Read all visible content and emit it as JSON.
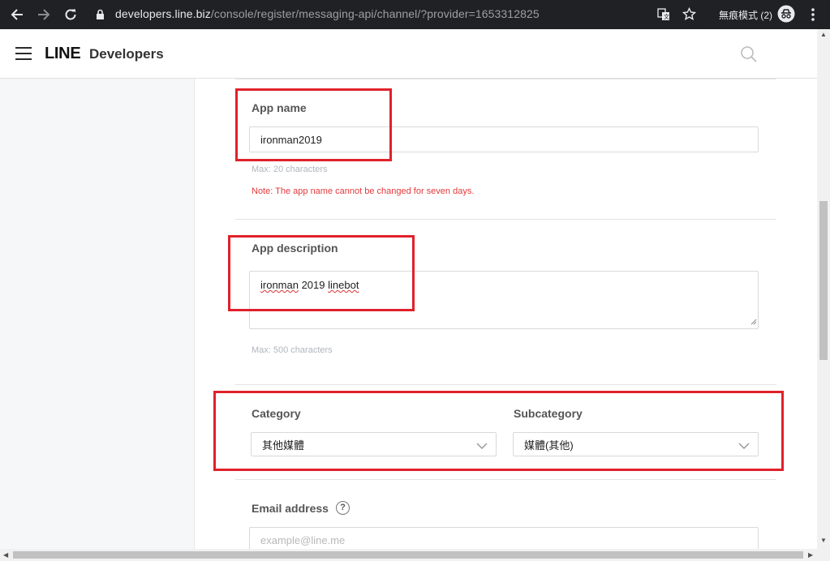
{
  "browser": {
    "url_host": "developers.line.biz",
    "url_path": "/console/register/messaging-api/channel/?provider=1653312825",
    "incognito_label": "無痕模式 (2)"
  },
  "header": {
    "brand_line": "LINE",
    "brand_developers": "Developers"
  },
  "form": {
    "app_name": {
      "label": "App name",
      "value": "ironman2019",
      "hint": "Max: 20 characters",
      "note": "Note: The app name cannot be changed for seven days."
    },
    "app_description": {
      "label": "App description",
      "value_part1": "ironman",
      "value_part2": " 2019 ",
      "value_part3": "linebot",
      "hint": "Max: 500 characters"
    },
    "category": {
      "label": "Category",
      "value": "其他媒體"
    },
    "subcategory": {
      "label": "Subcategory",
      "value": "媒體(其他)"
    },
    "email": {
      "label": "Email address",
      "help": "?",
      "placeholder": "example@line.me"
    }
  },
  "colors": {
    "highlight": "#e0212b",
    "note_red": "#e4393c",
    "chrome_bg": "#202124"
  }
}
